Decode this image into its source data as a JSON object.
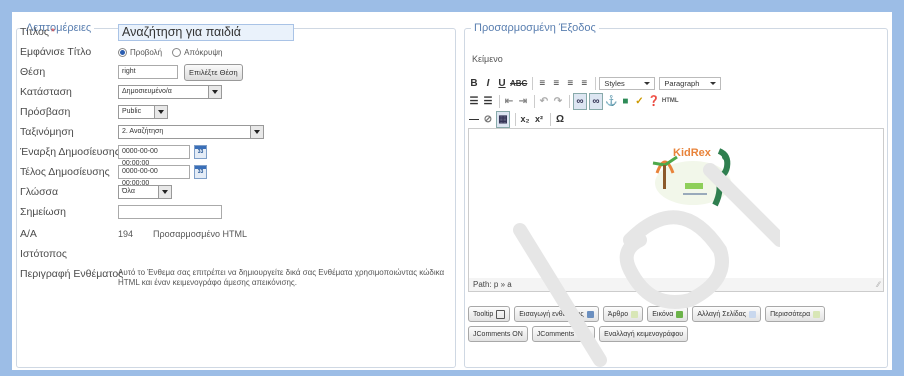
{
  "details": {
    "legend": "Λεπτομέρειες",
    "title_label": "Τίτλος",
    "title_required": "*",
    "title_value": "Αναζήτηση για παιδιά",
    "show_title_label": "Εμφάνισε Τίτλο",
    "show_title_options": [
      "Προβολή",
      "Απόκρυψη"
    ],
    "position_label": "Θέση",
    "position_value": "right",
    "position_button": "Επιλέξτε Θέση",
    "status_label": "Κατάσταση",
    "status_value": "Δημοσιευμένο/α",
    "access_label": "Πρόσβαση",
    "access_value": "Public",
    "ordering_label": "Ταξινόμηση",
    "ordering_value": "2. Αναζήτηση",
    "start_label": "Έναρξη Δημοσίευσης",
    "start_value": "0000-00-00 00:00:00",
    "end_label": "Τέλος Δημοσίευσης",
    "end_value": "0000-00-00 00:00:00",
    "lang_label": "Γλώσσα",
    "lang_value": "Όλα",
    "note_label": "Σημείωση",
    "note_value": "",
    "id_label": "Α/Α",
    "id_value": "194",
    "id_type": "Προσαρμοσμένο HTML",
    "site_label": "Ιστότοπος",
    "desc_label": "Περιγραφή Ενθέματος",
    "desc_text": "Αυτό το Ένθεμα σας επιτρέπει να δημιουργείτε δικά σας Ενθέματα χρησιμοποιώντας κώδικα HTML και έναν κειμενογράφο άμεσης απεικόνισης."
  },
  "custom_output": {
    "legend": "Προσαρμοσμένη Έξοδος",
    "text_label": "Κείμενο",
    "styles_select": "Styles",
    "paragraph_select": "Paragraph",
    "path_label": "Path: p » a",
    "logo_text": "KidRex",
    "buttons": [
      "Tooltip",
      "Εισαγωγή ενθέματος",
      "Άρθρο",
      "Εικόνα",
      "Αλλαγή Σελίδας",
      "Περισσότερα",
      "JComments ON",
      "JComments OFF",
      "Εναλλαγή κειμενογράφου"
    ]
  },
  "colors": {
    "frame": "#9cbde6",
    "legend": "#5a7fb0",
    "input_bg": "#eaf2fb"
  }
}
